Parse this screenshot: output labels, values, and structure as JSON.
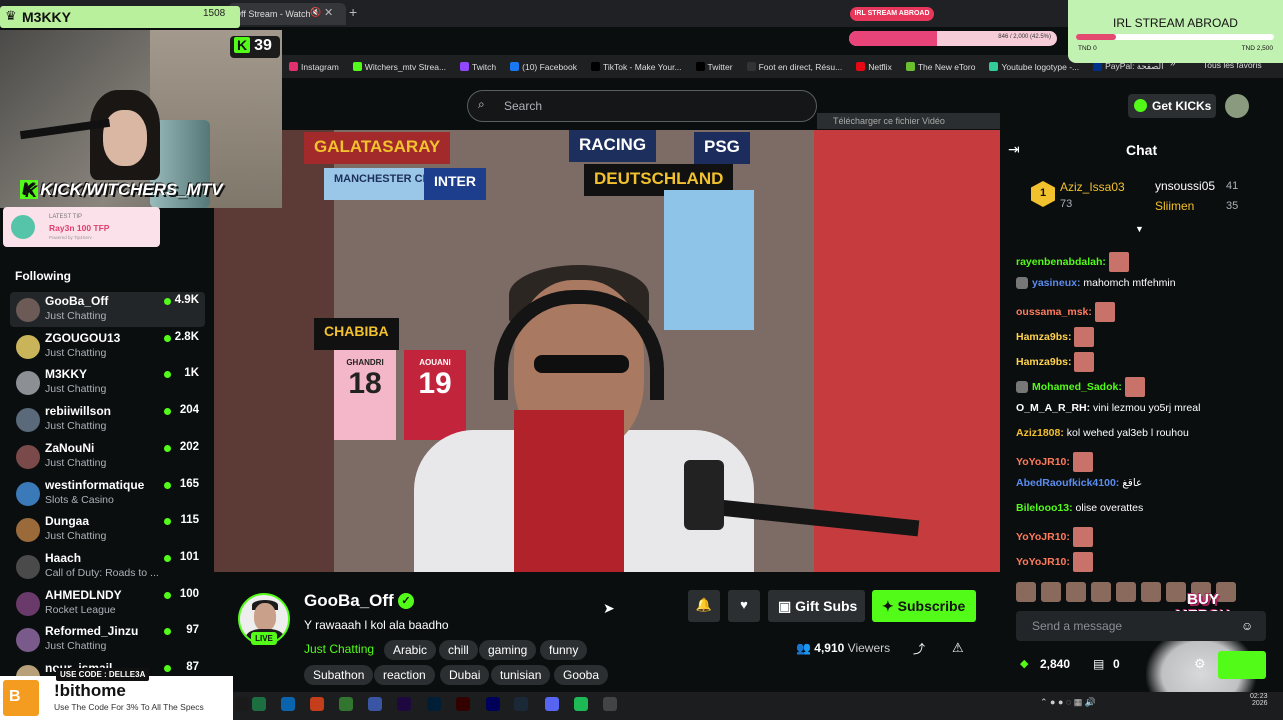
{
  "browser": {
    "tab_title": "Off Stream - Watch",
    "bookmarks": [
      {
        "label": "Instagram",
        "icon": "instagram-icon",
        "color": "#e1306c"
      },
      {
        "label": "Witchers_mtv Strea...",
        "icon": "kick-icon",
        "color": "#53fc18"
      },
      {
        "label": "Twitch",
        "icon": "twitch-icon",
        "color": "#9146ff"
      },
      {
        "label": "(10) Facebook",
        "icon": "facebook-icon",
        "color": "#1877f2"
      },
      {
        "label": "TikTok - Make Your...",
        "icon": "tiktok-icon",
        "color": "#000000"
      },
      {
        "label": "Twitter",
        "icon": "x-icon",
        "color": "#000000"
      },
      {
        "label": "Foot en direct, Résu...",
        "icon": "foot-icon",
        "color": "#333333"
      },
      {
        "label": "Netflix",
        "icon": "netflix-icon",
        "color": "#e50914"
      },
      {
        "label": "The New eToro",
        "icon": "etoro-icon",
        "color": "#6bbf2f"
      },
      {
        "label": "Youtube logotype -...",
        "icon": "vector-icon",
        "color": "#33cc99"
      },
      {
        "label": "PayPal: الصفحة",
        "icon": "paypal-icon",
        "color": "#003087"
      }
    ],
    "bookmark_folder": "Tous les favoris"
  },
  "overlay": {
    "username": "M3KKY",
    "count": "1508",
    "kick_count": "39",
    "handle_prefix": "K",
    "handle": "KICK/WITCHERS_MTV",
    "tip_label": "LATEST TIP",
    "tip_value": "Ray3n 100 TFP",
    "tip_footer": "Powered by Tip4Serv",
    "irl_label": "IRL STREAM ABROAD",
    "irl_progress_text": "846 / 2,000 (42.5%)",
    "irl_progress": 0.425,
    "irl_box_title": "IRL STREAM ABROAD",
    "irl_box_low": "TND 0",
    "irl_box_high": "TND 2,500",
    "irl_box_progress": 0.2
  },
  "sidebar": {
    "title": "Following",
    "items": [
      {
        "name": "GooBa_Off",
        "category": "Just Chatting",
        "viewers": "4.9K",
        "avatar_color": "#6b5a55"
      },
      {
        "name": "ZGOUGOU13",
        "category": "Just Chatting",
        "viewers": "2.8K",
        "avatar_color": "#c9b45a"
      },
      {
        "name": "M3KKY",
        "category": "Just Chatting",
        "viewers": "1K",
        "avatar_color": "#8c8f93"
      },
      {
        "name": "rebiiwillson",
        "category": "Just Chatting",
        "viewers": "204",
        "avatar_color": "#5a6a7a"
      },
      {
        "name": "ZaNouNi",
        "category": "Just Chatting",
        "viewers": "202",
        "avatar_color": "#7a4a4a"
      },
      {
        "name": "westinformatique",
        "category": "Slots & Casino",
        "viewers": "165",
        "avatar_color": "#3a7ab8"
      },
      {
        "name": "Dungaa",
        "category": "Just Chatting",
        "viewers": "115",
        "avatar_color": "#9a6a3a"
      },
      {
        "name": "Haach",
        "category": "Call of Duty: Roads to ...",
        "viewers": "101",
        "avatar_color": "#4a4a4a"
      },
      {
        "name": "AHMEDLNDY",
        "category": "Rocket League",
        "viewers": "100",
        "avatar_color": "#6a3a6a"
      },
      {
        "name": "Reformed_Jinzu",
        "category": "Just Chatting",
        "viewers": "97",
        "avatar_color": "#7a5a8a"
      },
      {
        "name": "nour_ismail",
        "category": "",
        "viewers": "87",
        "avatar_color": "#b8a07a"
      }
    ]
  },
  "promo": {
    "code_label": "USE CODE : DELLE3A",
    "title": "!bithome",
    "subtitle": "Use The Code For 3% To All The Specs",
    "logo_text": "B"
  },
  "search": {
    "placeholder": "Search"
  },
  "download_bar": "Télécharger ce fichier Vidéo",
  "video_scene": {
    "flags": [
      "GALATASARAY",
      "RACING",
      "PSG",
      "MANCHESTER CITY",
      "INTER",
      "DEUTSCHLAND",
      "CHABIBA"
    ],
    "jerseys": [
      {
        "name": "GHANDRI",
        "number": "18"
      },
      {
        "name": "AOUANI",
        "number": "19"
      }
    ]
  },
  "channel": {
    "name": "GooBa_Off",
    "live_label": "LIVE",
    "title": "Y rawaaah l kol ala baadho",
    "category": "Just Chatting",
    "tags": [
      "Arabic",
      "chill",
      "gaming",
      "funny",
      "Subathon",
      "reaction",
      "Dubai",
      "tunisian",
      "Gooba"
    ],
    "gift_label": "Gift Subs",
    "subscribe_label": "Subscribe",
    "viewers": "4,910",
    "viewers_label": "Viewers"
  },
  "header_right": {
    "get_kicks": "Get KICKs"
  },
  "chat": {
    "title": "Chat",
    "leaderboard": [
      {
        "rank": "1",
        "name": "Aziz_Issa03",
        "score": "73"
      },
      {
        "name": "ynsoussi05",
        "score": "41"
      },
      {
        "name": "Sliimen",
        "score": "35"
      }
    ],
    "messages": [
      {
        "user": "rayenbenabdalah:",
        "color": "#53fc18",
        "text": "",
        "emote": true
      },
      {
        "user": "yasineux:",
        "color": "#5b8def",
        "text": "mahomch mtfehmin",
        "emote": false,
        "badge": true
      },
      {
        "user": "oussama_msk:",
        "color": "#ff7b5c",
        "text": "",
        "emote": true
      },
      {
        "user": "Hamza9bs:",
        "color": "#ffd34d",
        "text": "",
        "emote": true
      },
      {
        "user": "Hamza9bs:",
        "color": "#ffd34d",
        "text": "",
        "emote": true
      },
      {
        "user": "Mohamed_Sadok:",
        "color": "#53fc18",
        "text": "",
        "emote": true,
        "badge": true
      },
      {
        "user": "O_M_A_R_RH:",
        "color": "#ffffff",
        "text": "vini lezmou yo5rj mreal",
        "emote": false
      },
      {
        "user": "Aziz1808:",
        "color": "#f2c12e",
        "text": "kol wehed yal3eb l rouhou",
        "emote": false
      },
      {
        "user": "YoYoJR10:",
        "color": "#ff7b5c",
        "text": "",
        "emote": true
      },
      {
        "user": "AbedRaoufkick4100:",
        "color": "#5b8def",
        "text": "عاقغ",
        "emote": false
      },
      {
        "user": "Bilelooo13:",
        "color": "#53fc18",
        "text": "olise overattes",
        "emote": false
      },
      {
        "user": "YoYoJR10:",
        "color": "#ff7b5c",
        "text": "",
        "emote": true
      },
      {
        "user": "YoYoJR10:",
        "color": "#ff7b5c",
        "text": "",
        "emote": true
      }
    ],
    "merch": "BUY MERCH NOW!",
    "input_placeholder": "Send a message",
    "points": "2,840",
    "store": "0"
  },
  "taskbar": {
    "icons": [
      "windows-icon",
      "excel-icon",
      "outlook-icon",
      "powerpoint-icon",
      "project-icon",
      "visio-icon",
      "aftereffects-icon",
      "photoshop-icon",
      "illustrator-icon",
      "premiere-icon",
      "steam-icon",
      "discord-icon",
      "spotify-icon",
      "chrome-icon"
    ],
    "time": "02:23",
    "date": "2026"
  }
}
